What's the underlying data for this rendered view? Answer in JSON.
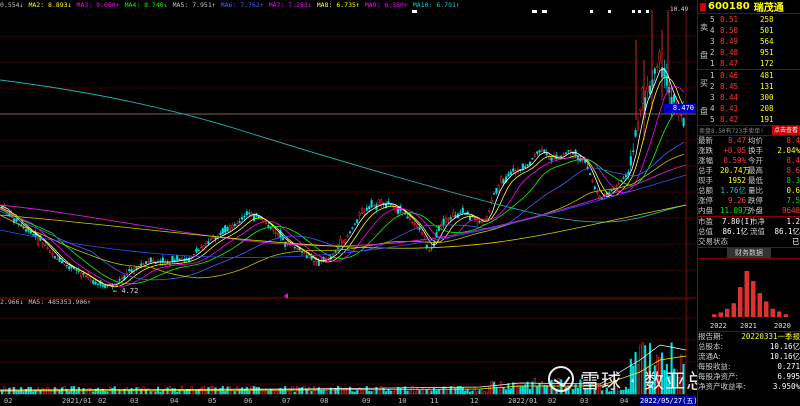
{
  "ma_bar": [
    {
      "text": "0.554↓",
      "color": "#c0c0c0"
    },
    {
      "text": "MA2: 8.893↓",
      "color": "#ffff00"
    },
    {
      "text": "MA3: 9.000↑",
      "color": "#ff00ff"
    },
    {
      "text": "MA4: 8.740↓",
      "color": "#00ff00"
    },
    {
      "text": "MA5: 7.951↑",
      "color": "#c0c0c0"
    },
    {
      "text": "MA6: 7.762↑",
      "color": "#4060ff"
    },
    {
      "text": "MA7: 7.283↓",
      "color": "#ff00ff"
    },
    {
      "text": "MA8: 6.735↑",
      "color": "#ffff00"
    },
    {
      "text": "MA9: 6.380↑",
      "color": "#ff00ff"
    },
    {
      "text": "MA10: 6.791↑",
      "color": "#00d0d0"
    }
  ],
  "vol_bar": [
    {
      "text": "2.966↓",
      "color": "#c0c0c0"
    },
    {
      "text": "MA5: 485353.906↑",
      "color": "#c0c0c0"
    }
  ],
  "chart_labels": {
    "high": "10.49",
    "low": "← 4.72",
    "last_price": "8.470"
  },
  "x_axis": [
    "02",
    "2021/01",
    "02",
    "03",
    "04",
    "05",
    "06",
    "07",
    "08",
    "09",
    "10",
    "11",
    "12",
    "2022/01",
    "02",
    "03",
    "04"
  ],
  "date_box": "2022/05/27(五)",
  "panel": {
    "code": "600180",
    "name": "瑞茂通",
    "sell_label": [
      "卖",
      "盘"
    ],
    "buy_label": [
      "买",
      "盘"
    ],
    "sells": [
      {
        "n": "5",
        "p": "8.51",
        "v": "258"
      },
      {
        "n": "4",
        "p": "8.50",
        "v": "501"
      },
      {
        "n": "3",
        "p": "8.49",
        "v": "564"
      },
      {
        "n": "2",
        "p": "8.48",
        "v": "951"
      },
      {
        "n": "1",
        "p": "8.47",
        "v": "172"
      }
    ],
    "buys": [
      {
        "n": "1",
        "p": "8.46",
        "v": "481"
      },
      {
        "n": "2",
        "p": "8.45",
        "v": "131"
      },
      {
        "n": "3",
        "p": "8.44",
        "v": "300"
      },
      {
        "n": "4",
        "p": "8.43",
        "v": "208"
      },
      {
        "n": "5",
        "p": "8.42",
        "v": "191"
      }
    ],
    "status_text": "卖盘8.50有723手卖单!",
    "status_button": "点击查看",
    "stats": [
      {
        "k": "最新",
        "v1": "8.47",
        "c1": "red",
        "k2": "均价",
        "v2": "8.4",
        "c2": "red"
      },
      {
        "k": "涨跌",
        "v1": "+0.05",
        "c1": "red",
        "k2": "换手",
        "v2": "2.04%",
        "c2": "yel"
      },
      {
        "k": "涨幅",
        "v1": "0.59%",
        "c1": "red",
        "k2": "今开",
        "v2": "8.4",
        "c2": "red"
      },
      {
        "k": "总手",
        "v1": "20.74万",
        "c1": "yel",
        "k2": "最高",
        "v2": "8.6",
        "c2": "red"
      },
      {
        "k": "现手",
        "v1": "1952",
        "c1": "yel",
        "k2": "最低",
        "v2": "8.3",
        "c2": "grn"
      },
      {
        "k": "总额",
        "v1": "1.76亿",
        "c1": "cya",
        "k2": "量比",
        "v2": "0.6",
        "c2": "yel"
      },
      {
        "k": "涨停",
        "v1": "9.26",
        "c1": "red",
        "k2": "跌停",
        "v2": "7.5",
        "c2": "grn"
      },
      {
        "k": "内盘",
        "v1": "11.09万",
        "c1": "grn",
        "k2": "外盘",
        "v2": "9648",
        "c2": "red"
      }
    ],
    "stats2": [
      {
        "k": "市盈",
        "v1": "7.80(I)",
        "c1": "wht",
        "k2": "市净",
        "v2": "1.2",
        "c2": "wht"
      },
      {
        "k": "总值",
        "v1": "86.1亿",
        "c1": "wht",
        "k2": "流值",
        "v2": "86.1亿",
        "c2": "wht"
      },
      {
        "k": "交易状态",
        "v1": "",
        "c1": "wht",
        "k2": "",
        "v2": "已闭市",
        "c2": "wht"
      }
    ],
    "tab_button": "财务数据",
    "mini_years": [
      "2022",
      "2021",
      "2020"
    ],
    "mini_bars": [
      0.06,
      0.1,
      0.18,
      0.3,
      0.65,
      1.0,
      0.78,
      0.52,
      0.34,
      0.18,
      0.12,
      0.06
    ],
    "report": [
      {
        "k": "报告期:",
        "v": "20220331一季报",
        "c": "yel"
      },
      {
        "k": "总股本:",
        "v": "10.16亿",
        "c": "wht"
      },
      {
        "k": "流通A:",
        "v": "10.16亿",
        "c": "wht"
      },
      {
        "k": "每股收益:",
        "v": "0.271",
        "c": "wht"
      },
      {
        "k": "每股净资产:",
        "v": "6.995",
        "c": "wht"
      },
      {
        "k": "净资产收益率:",
        "v": "3.950%",
        "c": "wht"
      }
    ]
  },
  "watermark": "雪球 · 数亚总舵主"
}
